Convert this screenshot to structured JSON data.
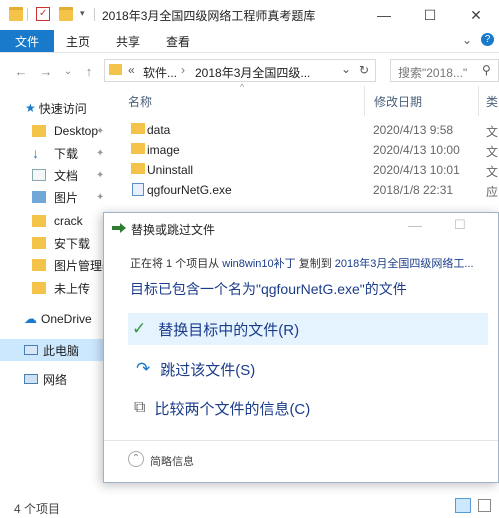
{
  "window": {
    "title": "2018年3月全国四级网络工程师真考题库",
    "controls": {
      "minimize": "—",
      "maximize": "☐",
      "close": "✕"
    }
  },
  "ribbon": {
    "tabs": [
      "文件",
      "主页",
      "共享",
      "查看"
    ],
    "collapse": "⌄",
    "help": "?"
  },
  "address": {
    "back": "←",
    "forward": "→",
    "recent": "⌄",
    "up": "↑",
    "overflow": "«",
    "crumbs": [
      "软件...",
      "2018年3月全国四级..."
    ],
    "sep": "›",
    "dropdown": "⌄",
    "refresh": "↻",
    "search_placeholder": "搜索\"2018...\""
  },
  "nav": {
    "quick_access": "快速访问",
    "items": [
      {
        "label": "Desktop",
        "icon": "folder-icon",
        "pinned": true
      },
      {
        "label": "下载",
        "icon": "download-icon",
        "pinned": true
      },
      {
        "label": "文档",
        "icon": "document-icon",
        "pinned": true
      },
      {
        "label": "图片",
        "icon": "picture-icon",
        "pinned": true
      },
      {
        "label": "crack",
        "icon": "folder-icon",
        "pinned": false
      },
      {
        "label": "安下载",
        "icon": "folder-icon",
        "pinned": false
      },
      {
        "label": "图片管理器",
        "icon": "folder-icon",
        "pinned": false
      },
      {
        "label": "未上传",
        "icon": "folder-icon",
        "pinned": false
      }
    ],
    "onedrive": "OneDrive",
    "this_pc": "此电脑",
    "network": "网络",
    "pin_glyph": "📌"
  },
  "columns": {
    "name": "名称",
    "modified": "修改日期",
    "type": "类"
  },
  "files": [
    {
      "name": "data",
      "date": "2020/4/13 9:58",
      "type": "文",
      "kind": "folder"
    },
    {
      "name": "image",
      "date": "2020/4/13 10:00",
      "type": "文",
      "kind": "folder"
    },
    {
      "name": "Uninstall",
      "date": "2020/4/13 10:01",
      "type": "文",
      "kind": "folder"
    },
    {
      "name": "qgfourNetG.exe",
      "date": "2018/1/8 22:31",
      "type": "应",
      "kind": "exe"
    }
  ],
  "status": {
    "count": "4 个项目"
  },
  "dialog": {
    "title": "替换或跳过文件",
    "progress_prefix": "正在将 1 个项目从",
    "progress_source": "win8win10补丁",
    "progress_mid": "复制到",
    "progress_dest": "2018年3月全国四级网络工...",
    "heading": "目标已包含一个名为\"qgfourNetG.exe\"的文件",
    "options": [
      {
        "label": "替换目标中的文件(R)",
        "icon": "checkmark-icon",
        "glyph": "✓"
      },
      {
        "label": "跳过该文件(S)",
        "icon": "skip-icon",
        "glyph": "↷"
      },
      {
        "label": "比较两个文件的信息(C)",
        "icon": "compare-icon",
        "glyph": "⧉"
      }
    ],
    "details": "简略信息",
    "details_glyph": "⌃"
  },
  "colors": {
    "accent": "#1979ca",
    "folder": "#f3c34a",
    "selection": "#cce8ff",
    "dialog_link": "#1a3c8a"
  }
}
